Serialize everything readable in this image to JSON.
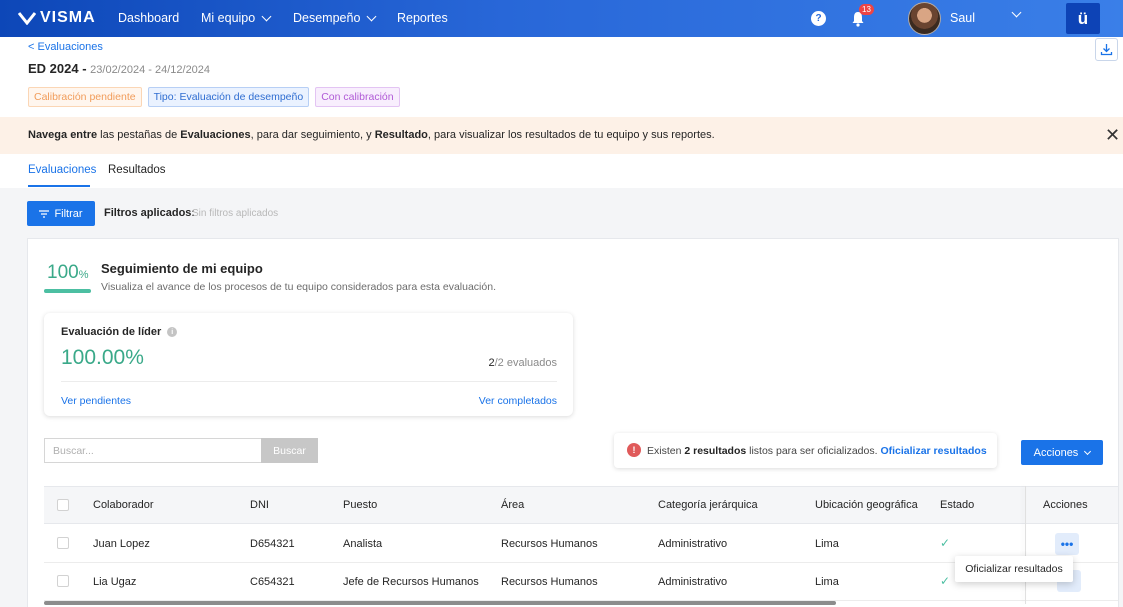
{
  "topnav": {
    "logo": "VISMA",
    "items": [
      {
        "label": "Dashboard"
      },
      {
        "label": "Mi equipo"
      },
      {
        "label": "Desempeño"
      },
      {
        "label": "Reportes"
      }
    ],
    "help": "?",
    "notif_count": "13",
    "user_name": "Saul",
    "app_icon": "ü"
  },
  "header": {
    "back_link": "< Evaluaciones",
    "title": "ED 2024 - ",
    "dates": "23/02/2024 - 24/12/2024",
    "tags": [
      "Calibración pendiente",
      "Tipo: Evaluación de desempeño",
      "Con calibración"
    ]
  },
  "banner": {
    "p1": "Navega entre",
    "p2": " las pestañas de ",
    "p3": "Evaluaciones",
    "p4": ", para dar seguimiento, y ",
    "p5": "Resultado",
    "p6": ", para visualizar los resultados de tu equipo y sus reportes.",
    "close": "✕"
  },
  "tabs": [
    {
      "label": "Evaluaciones",
      "active": true
    },
    {
      "label": "Resultados",
      "active": false
    }
  ],
  "filter": {
    "button": "Filtrar",
    "label": "Filtros aplicados:",
    "value": "Sin filtros aplicados"
  },
  "tracking": {
    "percent": "100",
    "percent_unit": "%",
    "progress": 1.0,
    "title": "Seguimiento de mi equipo",
    "subtitle": "Visualiza el avance de los procesos de tu equipo considerados para esta evaluación."
  },
  "eval_card": {
    "title": "Evaluación de líder",
    "percent": "100.00%",
    "count_done": "2",
    "count_rest": "/2 evaluados",
    "link_pending": "Ver pendientes",
    "link_done": "Ver completados"
  },
  "search": {
    "placeholder": "Buscar...",
    "button": "Buscar"
  },
  "notice": {
    "icon": "!",
    "pre": "Existen ",
    "bold": "2 resultados",
    "post": " listos para ser oficializados. ",
    "link": "Oficializar resultados"
  },
  "actions_button": "Acciones",
  "table": {
    "headers": [
      "Colaborador",
      "DNI",
      "Puesto",
      "Área",
      "Categoría jerárquica",
      "Ubicación geográfica",
      "Estado",
      "Acciones"
    ],
    "rows": [
      {
        "name": "Juan Lopez",
        "dni": "D654321",
        "puesto": "Analista",
        "area": "Recursos Humanos",
        "categoria": "Administrativo",
        "ubicacion": "Lima",
        "estado": "✓"
      },
      {
        "name": "Lia Ugaz",
        "dni": "C654321",
        "puesto": "Jefe de Recursos Humanos",
        "area": "Recursos Humanos",
        "categoria": "Administrativo",
        "ubicacion": "Lima",
        "estado": "✓"
      }
    ],
    "dots": "•••",
    "popup_item": "Oficializar resultados"
  },
  "colors": {
    "accent": "#1a73e8",
    "success": "#3aa989",
    "nav_gradient_start": "#0d47b8"
  }
}
